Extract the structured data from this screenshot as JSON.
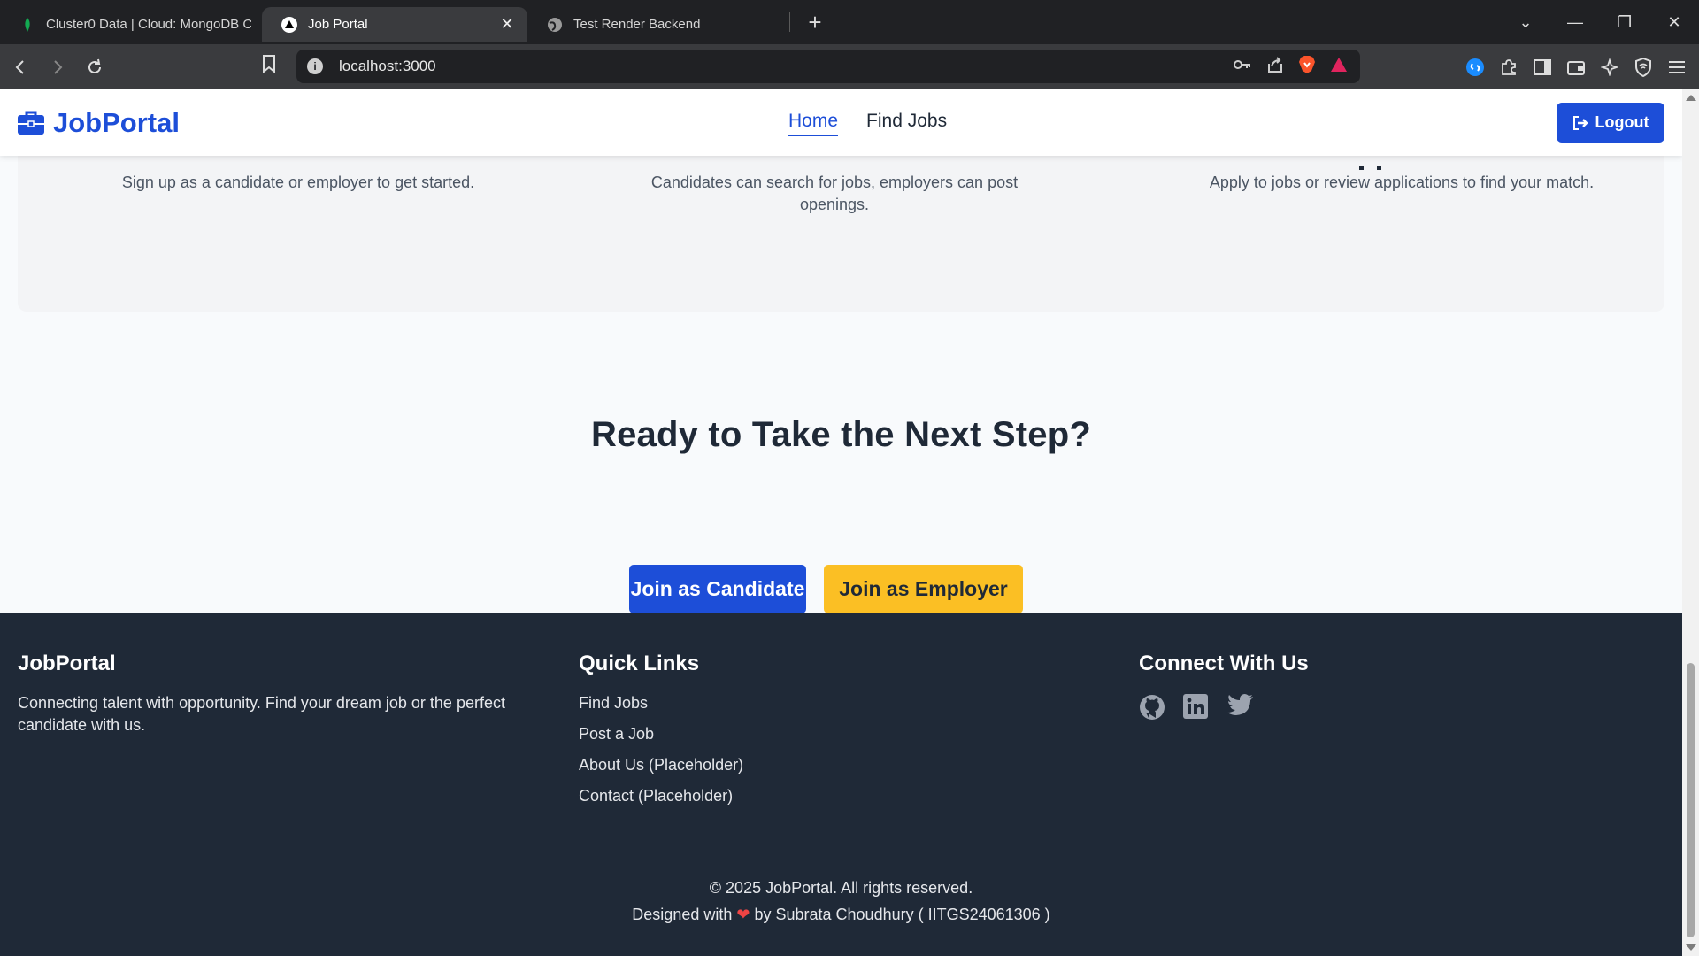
{
  "browser": {
    "tabs": [
      {
        "title": "Cluster0 Data | Cloud: MongoDB Clou",
        "icon": "mongodb-leaf-icon",
        "active": false
      },
      {
        "title": "Job Portal",
        "icon": "vercel-triangle-icon",
        "active": true
      },
      {
        "title": "Test Render Backend",
        "icon": "globe-icon",
        "active": false
      }
    ],
    "url": "localhost:3000"
  },
  "header": {
    "brand": "JobPortal",
    "nav": [
      {
        "label": "Home",
        "active": true
      },
      {
        "label": "Find Jobs",
        "active": false
      }
    ],
    "logout_label": "Logout"
  },
  "steps": [
    {
      "text": "Sign up as a candidate or employer to get started."
    },
    {
      "text": "Candidates can search for jobs, employers can post openings."
    },
    {
      "text": "Apply to jobs or review applications to find your match."
    }
  ],
  "cta": {
    "heading": "Ready to Take the Next Step?",
    "candidate_label": "Join as Candidate",
    "employer_label": "Join as Employer"
  },
  "footer": {
    "brand": "JobPortal",
    "tagline": "Connecting talent with opportunity. Find your dream job or the perfect candidate with us.",
    "quick_links_title": "Quick Links",
    "quick_links": [
      "Find Jobs",
      "Post a Job",
      "About Us (Placeholder)",
      "Contact (Placeholder)"
    ],
    "connect_title": "Connect With Us",
    "social": [
      "github-icon",
      "linkedin-icon",
      "twitter-icon"
    ],
    "copyright": "© 2025 JobPortal. All rights reserved.",
    "designed_prefix": "Designed with",
    "designed_suffix": "by Subrata Choudhury ( IITGS24061306 )"
  },
  "colors": {
    "primary": "#1d4ed8",
    "warning": "#fbbf24",
    "footer_bg": "#1f2937"
  }
}
